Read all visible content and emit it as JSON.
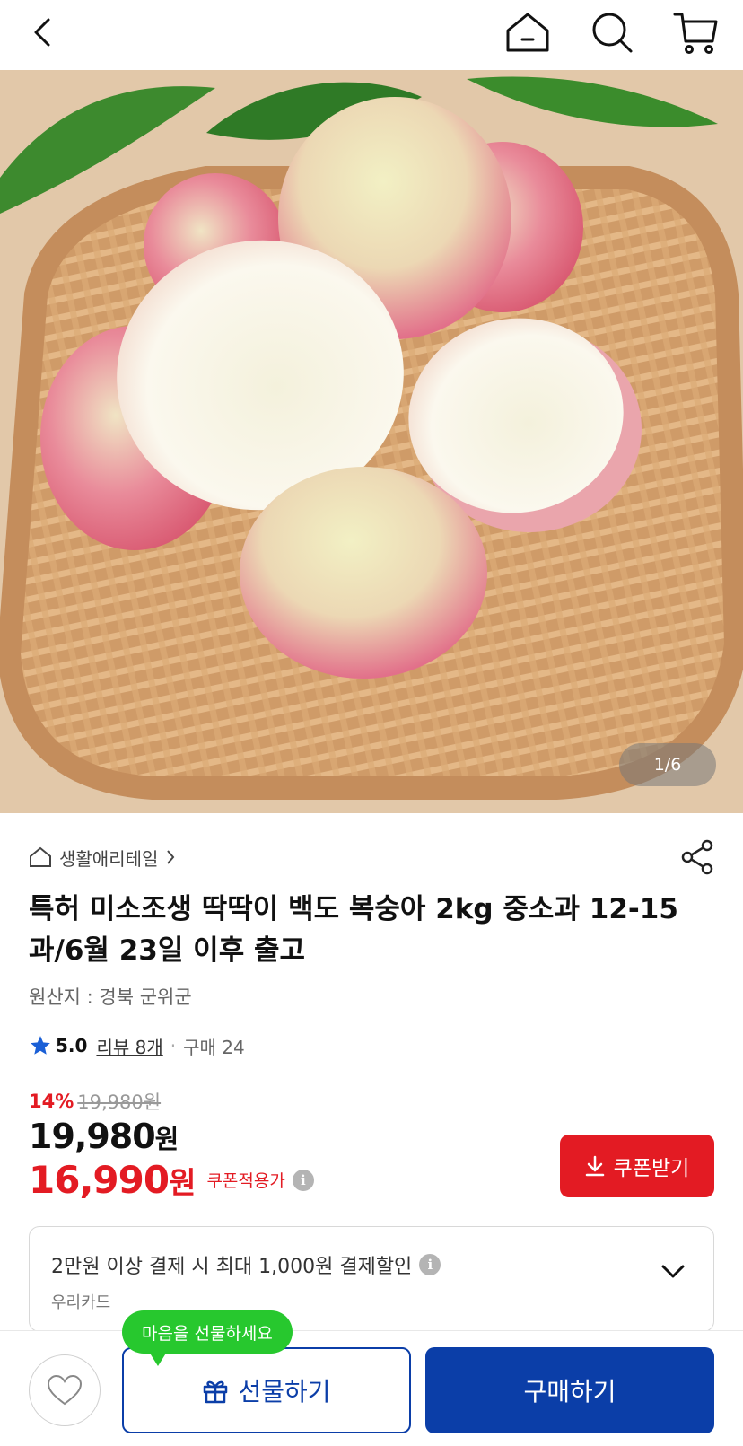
{
  "header": {
    "icons": [
      "back-icon",
      "home-icon",
      "search-icon",
      "cart-icon"
    ]
  },
  "hero": {
    "counter": "1/6"
  },
  "product": {
    "category": "생활애리테일",
    "title": "특허 미소조생 딱딱이 백도 복숭아 2kg 중소과 12-15과/6월 23일 이후 출고",
    "origin": "원산지 : 경북 군위군",
    "rating": "5.0",
    "reviews": "리뷰 8개",
    "separator": "·",
    "purchases": "구매 24",
    "discount_percent": "14%",
    "original_price": "19,980원",
    "price_value": "19,980",
    "price_unit": "원",
    "coupon_price_value": "16,990",
    "coupon_price_unit": "원",
    "coupon_price_label": "쿠폰적용가",
    "info_glyph": "i"
  },
  "coupon": {
    "button_label": "쿠폰받기",
    "accent_color": "#e31b23"
  },
  "card_promo": {
    "text": "2만원 이상 결제 시 최대 1,000원 결제할인",
    "card_name": "우리카드"
  },
  "bottom": {
    "tooltip": "마음을 선물하세요",
    "gift_label": "선물하기",
    "buy_label": "구매하기",
    "brand_color": "#0b3ea8",
    "tooltip_color": "#27c82e"
  }
}
